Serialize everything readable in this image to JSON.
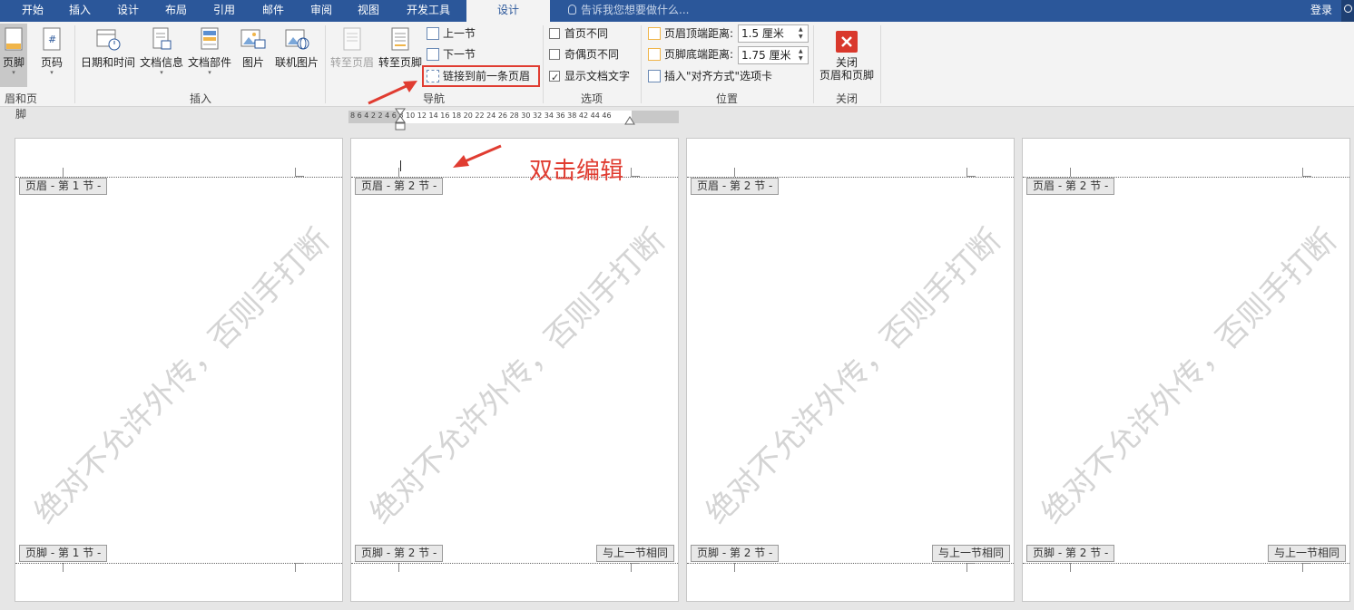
{
  "tabs": [
    "开始",
    "插入",
    "设计",
    "布局",
    "引用",
    "邮件",
    "审阅",
    "视图",
    "开发工具"
  ],
  "active_tab": "设计",
  "tell_me": "告诉我您想要做什么...",
  "login": "登录",
  "ribbon": {
    "group_header_footer": {
      "label": "眉和页脚",
      "footer_btn": "页脚",
      "pagenum_btn": "页码"
    },
    "group_insert": {
      "label": "插入",
      "datetime": "日期和时间",
      "docinfo": "文档信息",
      "parts": "文档部件",
      "picture": "图片",
      "online_picture": "联机图片"
    },
    "group_nav": {
      "label": "导航",
      "goto_header": "转至页眉",
      "goto_footer": "转至页脚",
      "prev_section": "上一节",
      "next_section": "下一节",
      "link_prev": "链接到前一条页眉"
    },
    "group_options": {
      "label": "选项",
      "diff_first": "首页不同",
      "diff_odd_even": "奇偶页不同",
      "show_doc_text": "显示文档文字"
    },
    "group_position": {
      "label": "位置",
      "header_top_label": "页眉顶端距离:",
      "header_top_value": "1.5 厘米",
      "footer_bottom_label": "页脚底端距离:",
      "footer_bottom_value": "1.75 厘米",
      "insert_align_tab": "插入\"对齐方式\"选项卡"
    },
    "group_close": {
      "label": "关闭",
      "close_line1": "关闭",
      "close_line2": "页眉和页脚"
    }
  },
  "ruler_text": "8  6  4  2      2   4   6   8  10 12 14 16 18 20 22 24 26 28 30 32 34 36 38     42 44 46",
  "annotation": "双击编辑",
  "watermark": "绝对不允许外传，否则手打断",
  "pages": [
    {
      "header_tag": "页眉 - 第 1 节 -",
      "footer_tag": "页脚 - 第 1 节 -",
      "same_as_prev": ""
    },
    {
      "header_tag": "页眉 - 第 2 节 -",
      "footer_tag": "页脚 - 第 2 节 -",
      "same_as_prev": "与上一节相同"
    },
    {
      "header_tag": "页眉 - 第 2 节 -",
      "footer_tag": "页脚 - 第 2 节 -",
      "same_as_prev": "与上一节相同"
    },
    {
      "header_tag": "页眉 - 第 2 节 -",
      "footer_tag": "页脚 - 第 2 节 -",
      "same_as_prev": "与上一节相同"
    }
  ],
  "colors": {
    "accent": "#2b579a",
    "annotation": "#e03c31",
    "close": "#d9382c"
  }
}
